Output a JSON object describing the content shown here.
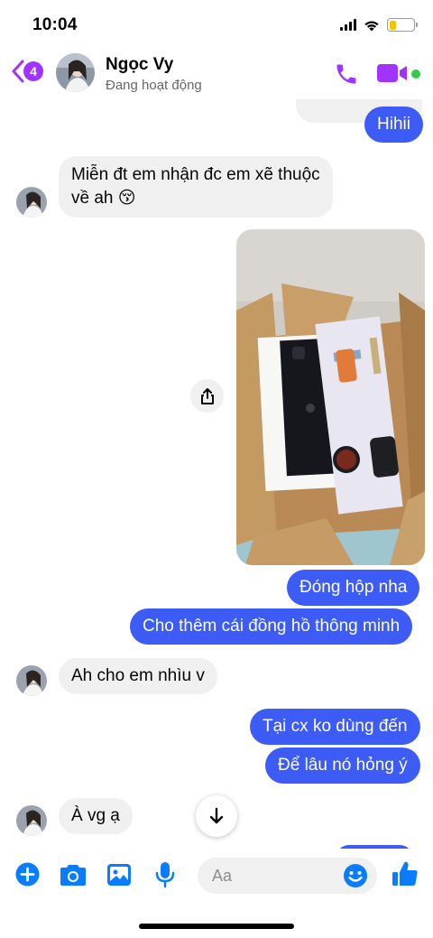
{
  "status_bar": {
    "time": "10:04",
    "battery_level": 0.3,
    "battery_color": "#f5c400"
  },
  "header": {
    "back_count": "4",
    "contact_name": "Ngọc Vy",
    "contact_status": "Đang hoạt động",
    "accent_color": "#a033ff",
    "online_color": "#31cc46",
    "icons": [
      "chevron-left-icon",
      "phone-icon",
      "video-camera-icon"
    ]
  },
  "messages": [
    {
      "from": "me",
      "text": "Hihii"
    },
    {
      "from": "contact",
      "lines": [
        "Miễn đt em nhận đc em xẽ thuộc",
        "về ah 😚"
      ]
    },
    {
      "from": "me",
      "type": "photo",
      "description_icon": "photo-image"
    },
    {
      "from": "me",
      "text": "Đóng hộp nha"
    },
    {
      "from": "me",
      "text": "Cho thêm cái đồng hồ thông minh"
    },
    {
      "from": "contact",
      "text": "Ah cho em nhìu v"
    },
    {
      "from": "me",
      "text": "Tại cx ko dùng đến"
    },
    {
      "from": "me",
      "text": "Để lâu nó hỏng ý"
    },
    {
      "from": "contact",
      "text": "À vg ạ"
    }
  ],
  "composer": {
    "placeholder": "Aa",
    "icons": [
      "plus-icon",
      "camera-icon",
      "gallery-icon",
      "microphone-icon",
      "emoji-icon",
      "thumbs-up-icon"
    ],
    "icon_color": "#0a7cff"
  },
  "colors": {
    "outgoing": "#3d5bf5",
    "incoming": "#f0f0f0"
  }
}
